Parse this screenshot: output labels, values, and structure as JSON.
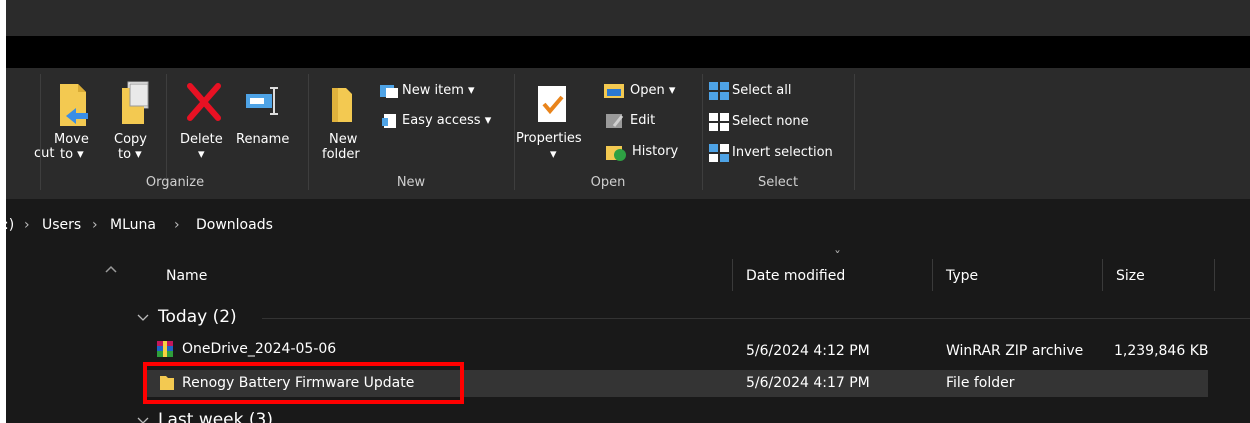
{
  "ribbon": {
    "cut_partial": "cut",
    "organize": {
      "group_label": "Organize",
      "move_to": [
        "Move",
        "to ▾"
      ],
      "copy_to": [
        "Copy",
        "to ▾"
      ],
      "delete": "Delete",
      "delete_arrow": "▾",
      "rename": "Rename"
    },
    "new": {
      "group_label": "New",
      "new_folder": [
        "New",
        "folder"
      ],
      "new_item": "New item ▾",
      "easy_access": "Easy access ▾"
    },
    "open": {
      "group_label": "Open",
      "properties": "Properties",
      "properties_arrow": "▾",
      "open": "Open ▾",
      "edit": "Edit",
      "history": "History"
    },
    "select": {
      "group_label": "Select",
      "select_all": "Select all",
      "select_none": "Select none",
      "invert_selection": "Invert selection"
    }
  },
  "address": {
    "partial": ":)",
    "crumbs": [
      "Users",
      "MLuna",
      "Downloads"
    ],
    "separator": "›"
  },
  "columns": {
    "name": "Name",
    "date_modified": "Date modified",
    "type": "Type",
    "size": "Size",
    "sort_indicator": "ˇ"
  },
  "groups": [
    {
      "title": "Today (2)",
      "items": [
        {
          "name": "OneDrive_2024-05-06",
          "date": "5/6/2024 4:12 PM",
          "type": "WinRAR ZIP archive",
          "size": "1,239,846 KB",
          "icon": "winrar-archive-icon"
        },
        {
          "name": "Renogy Battery Firmware Update",
          "date": "5/6/2024 4:17 PM",
          "type": "File folder",
          "size": "",
          "icon": "folder-icon"
        }
      ]
    },
    {
      "title": "Last week (3)"
    }
  ],
  "colors": {
    "highlight_box": "#ff0000",
    "selected_row": "#343434",
    "folder": "#f3c951",
    "accent_blue": "#4ea3e6"
  }
}
